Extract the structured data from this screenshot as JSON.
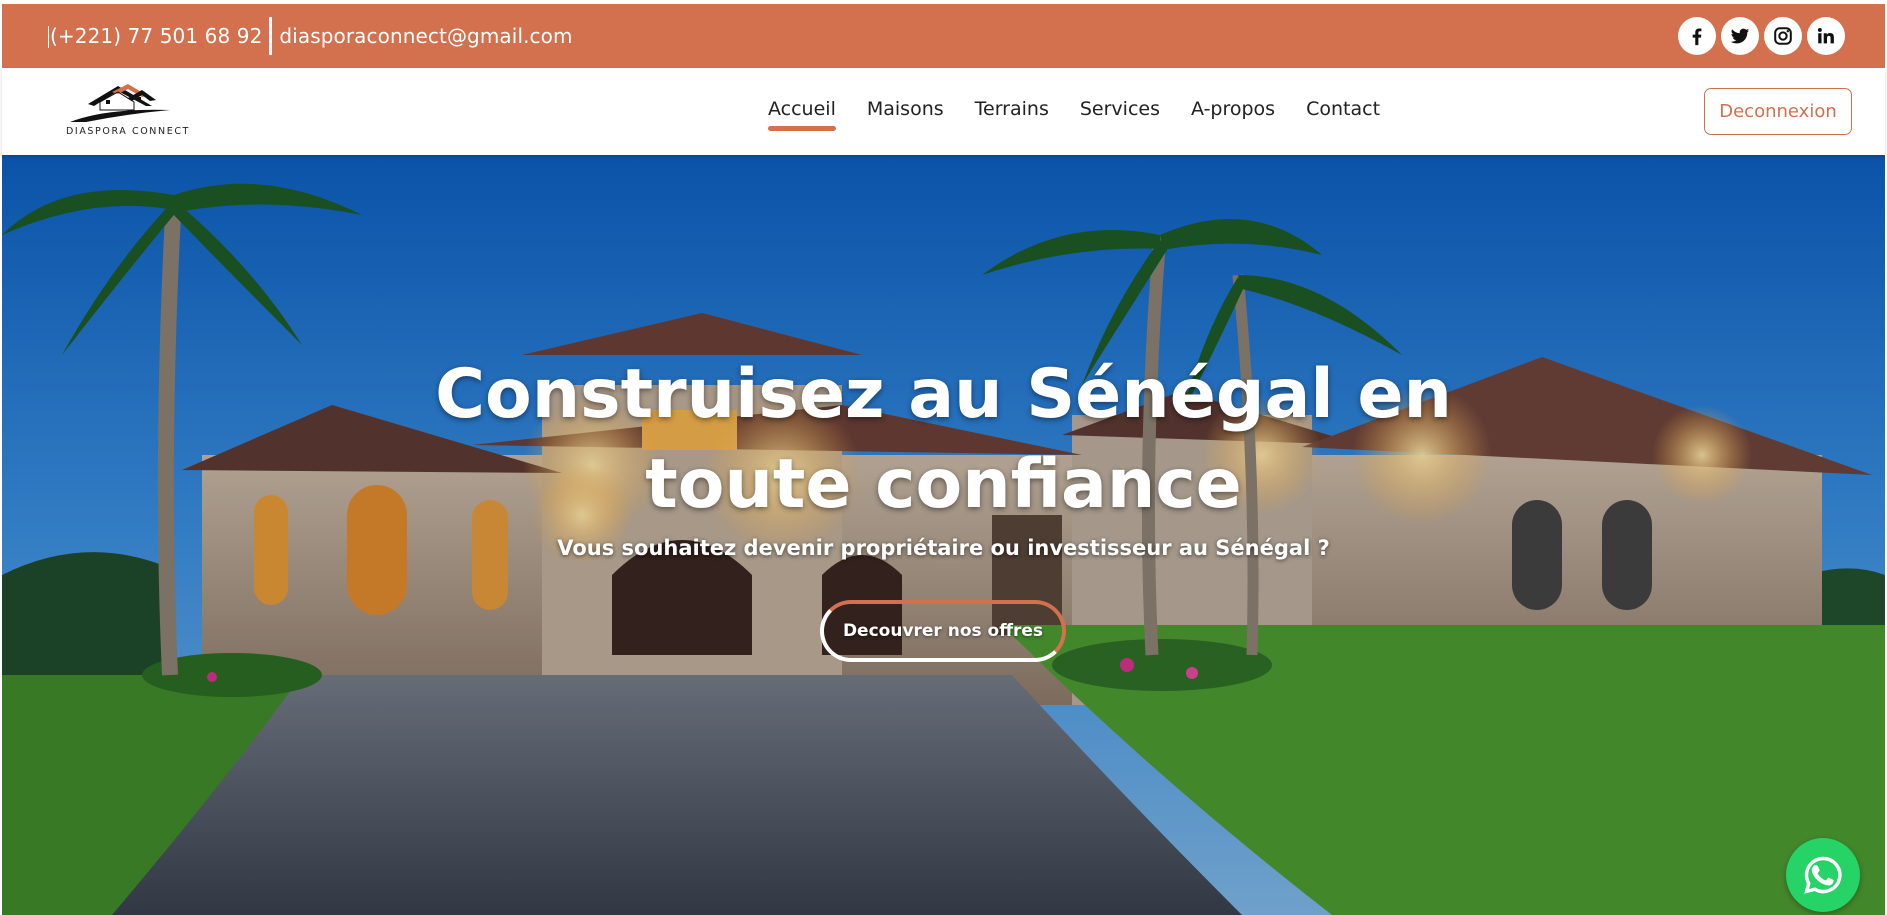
{
  "topbar": {
    "phone": "(+221) 77 501 68 92",
    "email": "diasporaconnect@gmail.com",
    "socials": [
      "facebook-icon",
      "twitter-icon",
      "instagram-icon",
      "linkedin-icon"
    ]
  },
  "brand": {
    "name": "DIASPORA CONNECT",
    "accent": "#d3714f"
  },
  "nav": {
    "items": [
      {
        "label": "Accueil",
        "active": true
      },
      {
        "label": "Maisons"
      },
      {
        "label": "Terrains"
      },
      {
        "label": "Services"
      },
      {
        "label": "A-propos"
      },
      {
        "label": "Contact"
      }
    ],
    "logout_label": "Deconnexion"
  },
  "hero": {
    "title_line1": "Construisez au Sénégal en",
    "title_line2": "toute confiance",
    "subtitle": "Vous souhaitez devenir propriétaire ou investisseur au Sénégal ?",
    "cta_label": "Decouvrer nos offres"
  },
  "floating": {
    "whatsapp_icon": "whatsapp-icon",
    "whatsapp_color": "#25d366"
  }
}
